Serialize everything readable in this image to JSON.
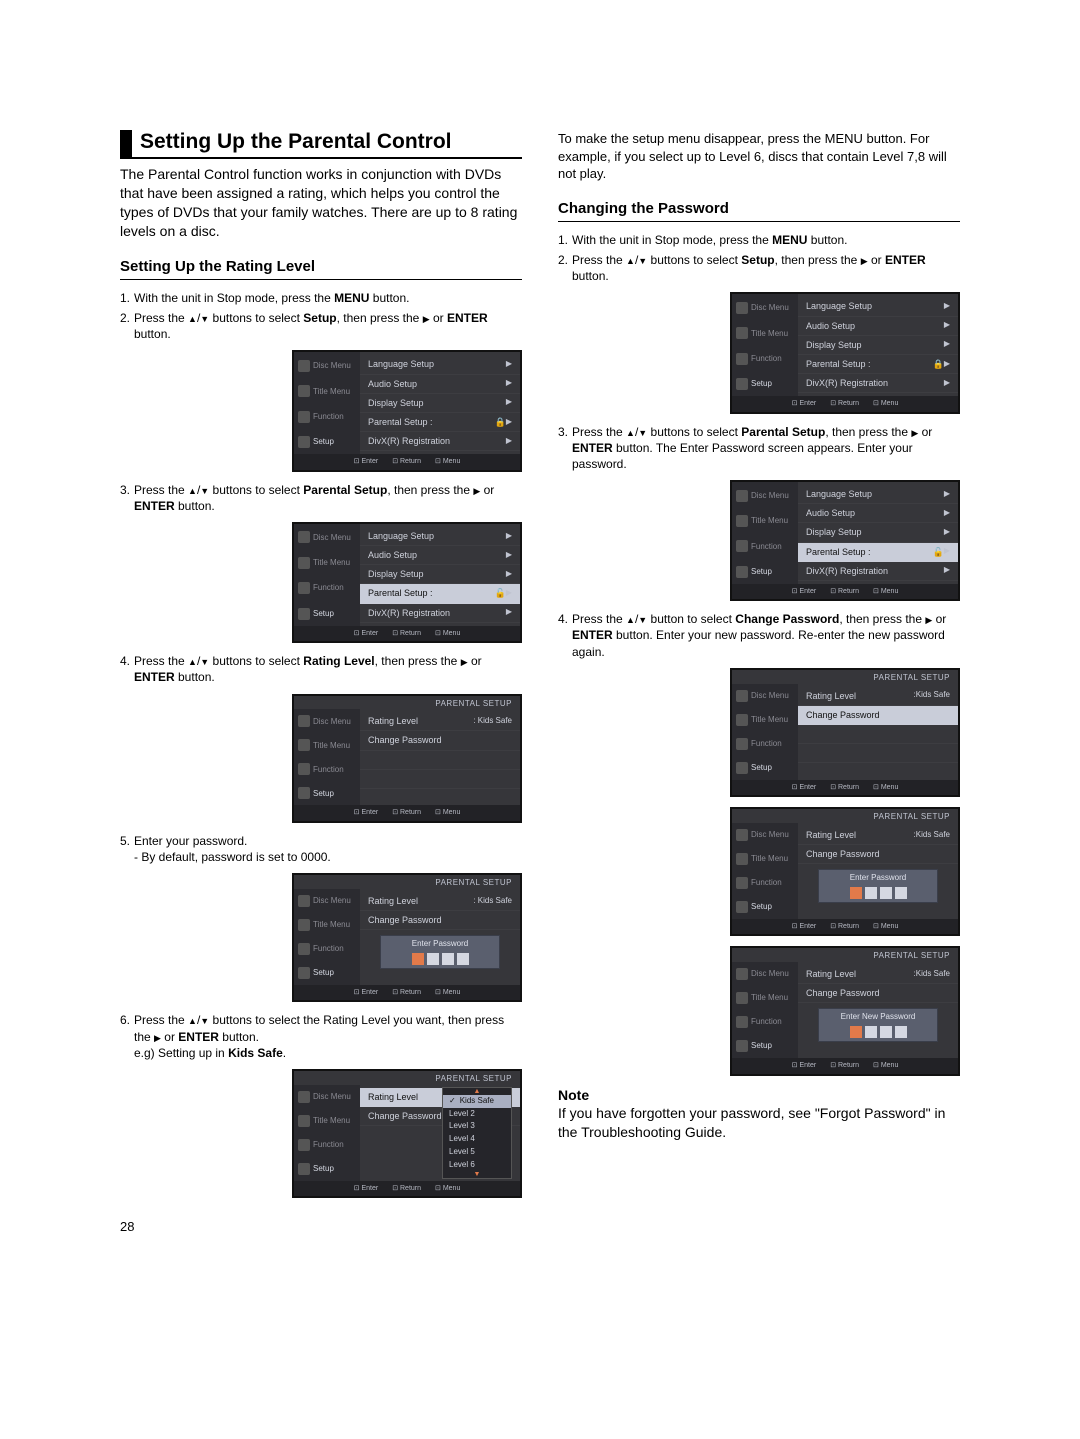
{
  "page_number": "28",
  "left": {
    "title": "Setting Up the Parental Control",
    "intro": "The Parental Control function works in conjunction with DVDs that have been assigned a rating, which helps you control the types of DVDs that your family watches. There are up to 8 rating levels on a disc.",
    "sub_heading": "Setting Up the Rating Level",
    "step1_a": "With the unit in Stop mode, press the ",
    "step1_b": "MENU",
    "step1_c": " button.",
    "step2_a": "Press the ",
    "step2_b": " buttons to select ",
    "step2_c": "Setup",
    "step2_d": ", then press the ",
    "step2_e": " or ",
    "step2_f": "ENTER",
    "step2_g": " button.",
    "step3_a": "Press the ",
    "step3_b": " buttons to select ",
    "step3_c": "Parental Setup",
    "step3_d": ", then press the ",
    "step3_e": " or ",
    "step3_f": "ENTER",
    "step3_g": " button.",
    "step4_a": "Press the ",
    "step4_b": " buttons to select ",
    "step4_c": "Rating Level",
    "step4_d": ", then press the ",
    "step4_e": " or ",
    "step4_f": "ENTER",
    "step4_g": " button.",
    "step5_a": "Enter your password.",
    "step5_b": "- By default, password is set to 0000.",
    "step6_a": "Press the ",
    "step6_b": " buttons to select the Rating Level you want, then press the ",
    "step6_c": " or ",
    "step6_d": "ENTER",
    "step6_e": " button.",
    "step6_f": "e.g) Setting up in ",
    "step6_g": "Kids Safe",
    "step6_h": "."
  },
  "right": {
    "top_para": "To make the setup menu disappear, press the MENU button. For example, if you select up to Level 6, discs that contain Level 7,8 will not play.",
    "sub_heading": "Changing the Password",
    "step1_a": "With the unit in Stop mode, press the ",
    "step1_b": "MENU",
    "step1_c": " button.",
    "step2_a": "Press the ",
    "step2_b": " buttons to select ",
    "step2_c": "Setup",
    "step2_d": ", then press the ",
    "step2_e": " or ",
    "step2_f": "ENTER",
    "step2_g": " button.",
    "step3_a": "Press the ",
    "step3_b": " buttons to select ",
    "step3_c": "Parental Setup",
    "step3_d": ", then press the ",
    "step3_e": " or ",
    "step3_f": "ENTER",
    "step3_g": " button. The Enter Password screen appears. Enter your password.",
    "step4_a": "Press the ",
    "step4_b": " button to select ",
    "step4_c": "Change Password",
    "step4_d": ", then press the ",
    "step4_e": " or ",
    "step4_f": "ENTER",
    "step4_g": " button. Enter your new password. Re-enter the new password again.",
    "note_head": "Note",
    "note_body": "If you have forgotten your password, see \"Forgot Password\" in the Troubleshooting Guide."
  },
  "osd": {
    "sidebar": {
      "disc": "Disc Menu",
      "title": "Title Menu",
      "func": "Function",
      "setup": "Setup"
    },
    "footer": {
      "enter": "Enter",
      "return": "Return",
      "menu": "Menu"
    },
    "header_parental": "PARENTAL  SETUP",
    "setup_items": {
      "lang": "Language Setup",
      "audio": "Audio Setup",
      "display": "Display Setup",
      "parental": "Parental Setup :",
      "divx": "DivX(R) Registration"
    },
    "parental_items": {
      "rating": "Rating Level",
      "rating_val": ": Kids Safe",
      "rating_val2": ":Kids Safe",
      "change": "Change Password"
    },
    "enter_pw": "Enter Password",
    "enter_new_pw": "Enter New Password",
    "levels": {
      "kids": "Kids Safe",
      "l2": "Level 2",
      "l3": "Level 3",
      "l4": "Level 4",
      "l5": "Level 5",
      "l6": "Level 6"
    }
  }
}
